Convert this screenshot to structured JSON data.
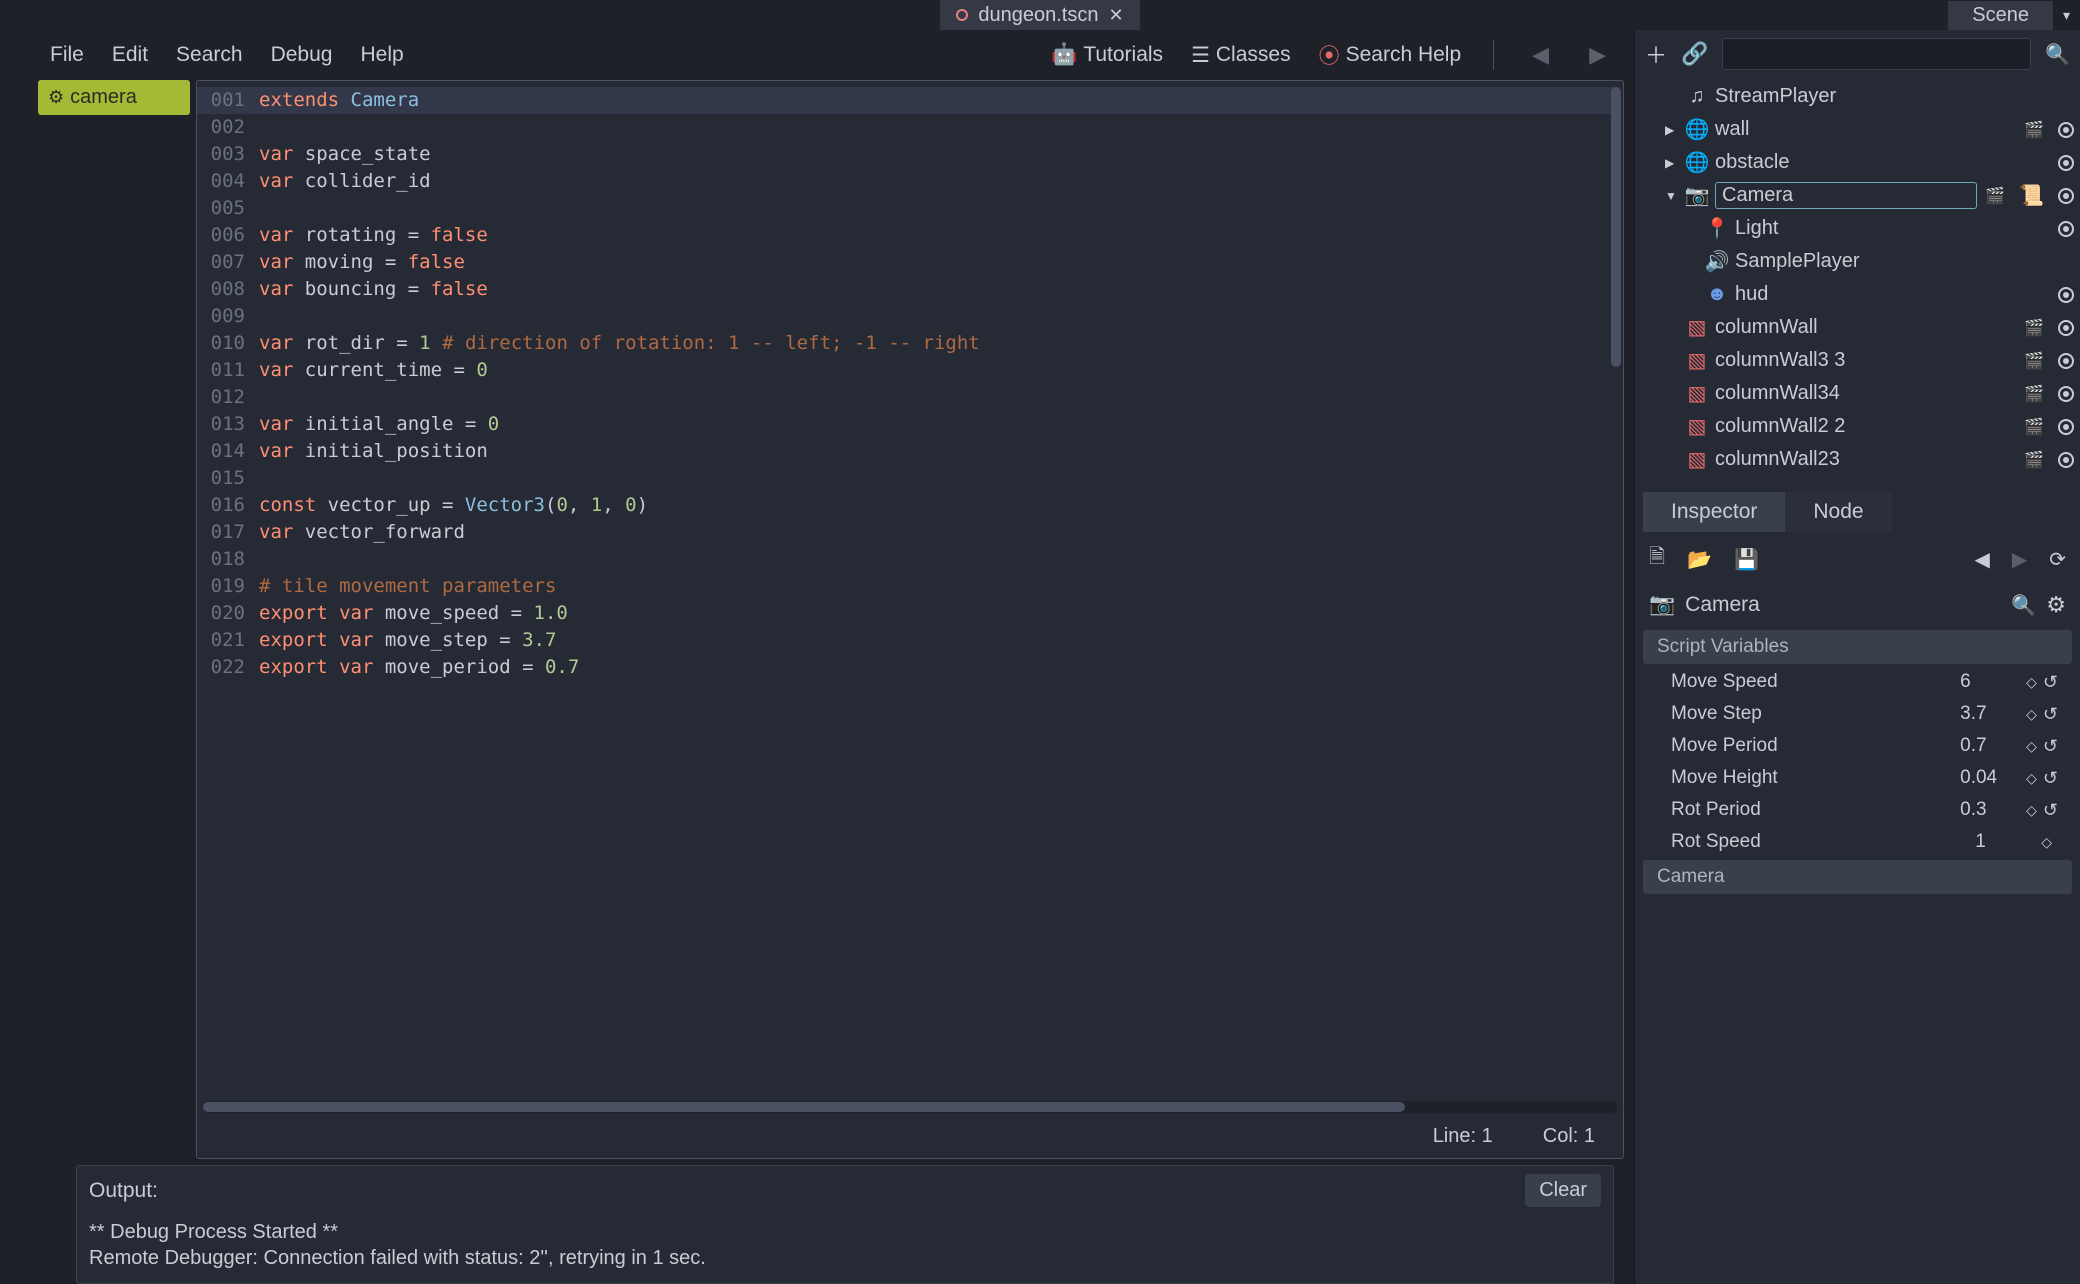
{
  "top_tab": {
    "name": "dungeon.tscn"
  },
  "menubar": {
    "file": "File",
    "edit": "Edit",
    "search": "Search",
    "debug": "Debug",
    "help": "Help",
    "tutorials": "Tutorials",
    "classes": "Classes",
    "search_help": "Search Help"
  },
  "script_list": {
    "active": "camera"
  },
  "code": {
    "lines": [
      {
        "n": "001",
        "seg": [
          [
            "kw",
            "extends "
          ],
          [
            "type",
            "Camera"
          ]
        ]
      },
      {
        "n": "002",
        "seg": []
      },
      {
        "n": "003",
        "seg": [
          [
            "kw",
            "var"
          ],
          [
            "",
            " space_state"
          ]
        ]
      },
      {
        "n": "004",
        "seg": [
          [
            "kw",
            "var"
          ],
          [
            "",
            " collider_id"
          ]
        ]
      },
      {
        "n": "005",
        "seg": []
      },
      {
        "n": "006",
        "seg": [
          [
            "kw",
            "var"
          ],
          [
            "",
            " rotating = "
          ],
          [
            "kw",
            "false"
          ]
        ]
      },
      {
        "n": "007",
        "seg": [
          [
            "kw",
            "var"
          ],
          [
            "",
            " moving = "
          ],
          [
            "kw",
            "false"
          ]
        ]
      },
      {
        "n": "008",
        "seg": [
          [
            "kw",
            "var"
          ],
          [
            "",
            " bouncing = "
          ],
          [
            "kw",
            "false"
          ]
        ]
      },
      {
        "n": "009",
        "seg": []
      },
      {
        "n": "010",
        "seg": [
          [
            "kw",
            "var"
          ],
          [
            "",
            " rot_dir = "
          ],
          [
            "num",
            "1"
          ],
          [
            "",
            " "
          ],
          [
            "cmt",
            "# direction of rotation: 1 -- left; -1 -- right"
          ]
        ]
      },
      {
        "n": "011",
        "seg": [
          [
            "kw",
            "var"
          ],
          [
            "",
            " current_time = "
          ],
          [
            "num",
            "0"
          ]
        ]
      },
      {
        "n": "012",
        "seg": []
      },
      {
        "n": "013",
        "seg": [
          [
            "kw",
            "var"
          ],
          [
            "",
            " initial_angle = "
          ],
          [
            "num",
            "0"
          ]
        ]
      },
      {
        "n": "014",
        "seg": [
          [
            "kw",
            "var"
          ],
          [
            "",
            " initial_position"
          ]
        ]
      },
      {
        "n": "015",
        "seg": []
      },
      {
        "n": "016",
        "seg": [
          [
            "kw",
            "const"
          ],
          [
            "",
            " vector_up = "
          ],
          [
            "type",
            "Vector3"
          ],
          [
            "",
            "("
          ],
          [
            "num",
            "0"
          ],
          [
            "",
            ", "
          ],
          [
            "num",
            "1"
          ],
          [
            "",
            ", "
          ],
          [
            "num",
            "0"
          ],
          [
            "",
            ")"
          ]
        ]
      },
      {
        "n": "017",
        "seg": [
          [
            "kw",
            "var"
          ],
          [
            "",
            " vector_forward"
          ]
        ]
      },
      {
        "n": "018",
        "seg": []
      },
      {
        "n": "019",
        "seg": [
          [
            "cmt",
            "# tile movement parameters"
          ]
        ]
      },
      {
        "n": "020",
        "seg": [
          [
            "kw",
            "export var"
          ],
          [
            "",
            " move_speed = "
          ],
          [
            "num",
            "1.0"
          ]
        ]
      },
      {
        "n": "021",
        "seg": [
          [
            "kw",
            "export var"
          ],
          [
            "",
            " move_step = "
          ],
          [
            "num",
            "3.7"
          ]
        ]
      },
      {
        "n": "022",
        "seg": [
          [
            "kw",
            "export var"
          ],
          [
            "",
            " move_period = "
          ],
          [
            "num",
            "0.7"
          ]
        ]
      }
    ]
  },
  "status": {
    "line": "Line: 1",
    "col": "Col: 1"
  },
  "output": {
    "title": "Output:",
    "clear": "Clear",
    "lines": [
      "** Debug Process Started **",
      "Remote Debugger: Connection failed with status: 2'', retrying in 1 sec."
    ]
  },
  "scene": {
    "tab": "Scene",
    "nodes": [
      {
        "indent": 1,
        "icon": "music",
        "iconcolor": "",
        "label": "StreamPlayer",
        "vis": false,
        "clap": false,
        "arrow": ""
      },
      {
        "indent": 1,
        "icon": "globe",
        "iconcolor": "ico-red",
        "label": "wall",
        "vis": true,
        "clap": true,
        "arrow": "▶"
      },
      {
        "indent": 1,
        "icon": "globe",
        "iconcolor": "ico-red",
        "label": "obstacle",
        "vis": true,
        "clap": false,
        "arrow": "▶"
      },
      {
        "indent": 1,
        "icon": "cam",
        "iconcolor": "ico-pink",
        "label": "Camera",
        "vis": true,
        "clap": true,
        "script": true,
        "arrow": "▼",
        "selected": true
      },
      {
        "indent": 2,
        "icon": "pin",
        "iconcolor": "ico-red",
        "label": "Light",
        "vis": true,
        "clap": false,
        "arrow": ""
      },
      {
        "indent": 2,
        "icon": "speaker",
        "iconcolor": "",
        "label": "SamplePlayer",
        "vis": false,
        "clap": false,
        "arrow": ""
      },
      {
        "indent": 2,
        "icon": "face",
        "iconcolor": "ico-face",
        "label": "hud",
        "vis": true,
        "clap": false,
        "arrow": ""
      },
      {
        "indent": 1,
        "icon": "mesh",
        "iconcolor": "ico-red",
        "label": "columnWall",
        "vis": true,
        "clap": true,
        "arrow": ""
      },
      {
        "indent": 1,
        "icon": "mesh",
        "iconcolor": "ico-red",
        "label": "columnWall3 3",
        "vis": true,
        "clap": true,
        "arrow": ""
      },
      {
        "indent": 1,
        "icon": "mesh",
        "iconcolor": "ico-red",
        "label": "columnWall34",
        "vis": true,
        "clap": true,
        "arrow": ""
      },
      {
        "indent": 1,
        "icon": "mesh",
        "iconcolor": "ico-red",
        "label": "columnWall2 2",
        "vis": true,
        "clap": true,
        "arrow": ""
      },
      {
        "indent": 1,
        "icon": "mesh",
        "iconcolor": "ico-red",
        "label": "columnWall23",
        "vis": true,
        "clap": true,
        "arrow": ""
      }
    ]
  },
  "inspector": {
    "tabs": {
      "inspector": "Inspector",
      "node": "Node"
    },
    "node": "Camera",
    "section_vars": "Script Variables",
    "section_cam": "Camera",
    "props": [
      {
        "name": "Move Speed",
        "value": "6",
        "reset": true
      },
      {
        "name": "Move Step",
        "value": "3.7",
        "reset": true
      },
      {
        "name": "Move Period",
        "value": "0.7",
        "reset": true
      },
      {
        "name": "Move Height",
        "value": "0.04",
        "reset": true
      },
      {
        "name": "Rot Period",
        "value": "0.3",
        "reset": true
      },
      {
        "name": "Rot Speed",
        "value": "1",
        "reset": false
      }
    ]
  }
}
